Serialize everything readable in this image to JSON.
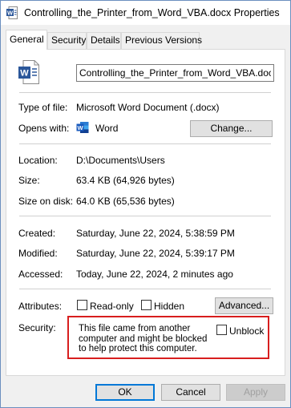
{
  "window": {
    "title": "Controlling_the_Printer_from_Word_VBA.docx Properties",
    "icon": "word-doc-icon"
  },
  "tabs": [
    {
      "label": "General",
      "active": true
    },
    {
      "label": "Security",
      "active": false
    },
    {
      "label": "Details",
      "active": false
    },
    {
      "label": "Previous Versions",
      "active": false
    }
  ],
  "general": {
    "filename": "Controlling_the_Printer_from_Word_VBA.docx",
    "type_label": "Type of file:",
    "type_value": "Microsoft Word Document (.docx)",
    "opens_label": "Opens with:",
    "opens_value": "Word",
    "change_button": "Change...",
    "location_label": "Location:",
    "location_value": "D:\\Documents\\Users",
    "size_label": "Size:",
    "size_value": "63.4 KB (64,926 bytes)",
    "size_on_disk_label": "Size on disk:",
    "size_on_disk_value": "64.0 KB (65,536 bytes)",
    "created_label": "Created:",
    "created_value": "Saturday, June 22, 2024, 5:38:59 PM",
    "modified_label": "Modified:",
    "modified_value": "Saturday, June 22, 2024, 5:39:17 PM",
    "accessed_label": "Accessed:",
    "accessed_value": "Today, June 22, 2024, 2 minutes ago",
    "attributes_label": "Attributes:",
    "readonly_label": "Read-only",
    "hidden_label": "Hidden",
    "advanced_button": "Advanced...",
    "security_label": "Security:",
    "security_text": "This file came from another computer and might be blocked to help protect this computer.",
    "unblock_label": "Unblock",
    "security_highlight_color": "#d81e1e"
  },
  "footer": {
    "ok": "OK",
    "cancel": "Cancel",
    "apply": "Apply"
  }
}
